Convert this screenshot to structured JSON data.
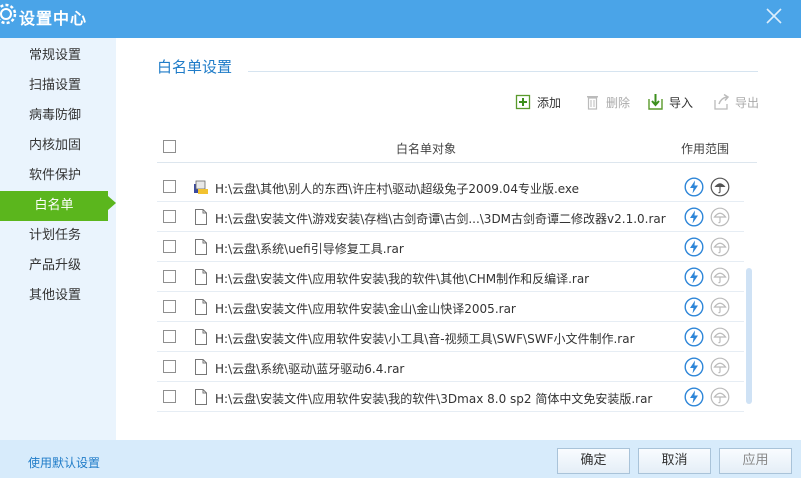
{
  "window": {
    "title": "设置中心",
    "accent_color": "#4aa4e8",
    "active_color": "#5bb61d"
  },
  "sidebar": {
    "items": [
      {
        "label": "常规设置"
      },
      {
        "label": "扫描设置"
      },
      {
        "label": "病毒防御"
      },
      {
        "label": "内核加固"
      },
      {
        "label": "软件保护"
      },
      {
        "label": "白名单"
      },
      {
        "label": "计划任务"
      },
      {
        "label": "产品升级"
      },
      {
        "label": "其他设置"
      }
    ],
    "active_index": 5
  },
  "main": {
    "section_title": "白名单设置",
    "toolbar": {
      "add": "添加",
      "delete": "删除",
      "import": "导入",
      "export": "导出"
    },
    "table": {
      "col_object": "白名单对象",
      "col_scope": "作用范围",
      "rows": [
        {
          "path": "H:\\云盘\\其他\\别人的东西\\许庄村\\驱动\\超级兔子2009.04专业版.exe",
          "icon": "exe-icon",
          "umbrella_active": true
        },
        {
          "path": "H:\\云盘\\安装文件\\游戏安装\\存档\\古剑奇谭\\古剑...\\3DM古剑奇谭二修改器v2.1.0.rar",
          "icon": "file-icon",
          "umbrella_active": false
        },
        {
          "path": "H:\\云盘\\系统\\uefi引导修复工具.rar",
          "icon": "file-icon",
          "umbrella_active": false
        },
        {
          "path": "H:\\云盘\\安装文件\\应用软件安装\\我的软件\\其他\\CHM制作和反编译.rar",
          "icon": "file-icon",
          "umbrella_active": false
        },
        {
          "path": "H:\\云盘\\安装文件\\应用软件安装\\金山\\金山快译2005.rar",
          "icon": "file-icon",
          "umbrella_active": false
        },
        {
          "path": "H:\\云盘\\安装文件\\应用软件安装\\小工具\\音-视频工具\\SWF\\SWF小文件制作.rar",
          "icon": "file-icon",
          "umbrella_active": false
        },
        {
          "path": "H:\\云盘\\系统\\驱动\\蓝牙驱动6.4.rar",
          "icon": "file-icon",
          "umbrella_active": false
        },
        {
          "path": "H:\\云盘\\安装文件\\应用软件安装\\我的软件\\3Dmax 8.0 sp2 简体中文免安装版.rar",
          "icon": "file-icon",
          "umbrella_active": false
        }
      ]
    }
  },
  "footer": {
    "default_link": "使用默认设置",
    "ok": "确定",
    "cancel": "取消",
    "apply": "应用"
  }
}
